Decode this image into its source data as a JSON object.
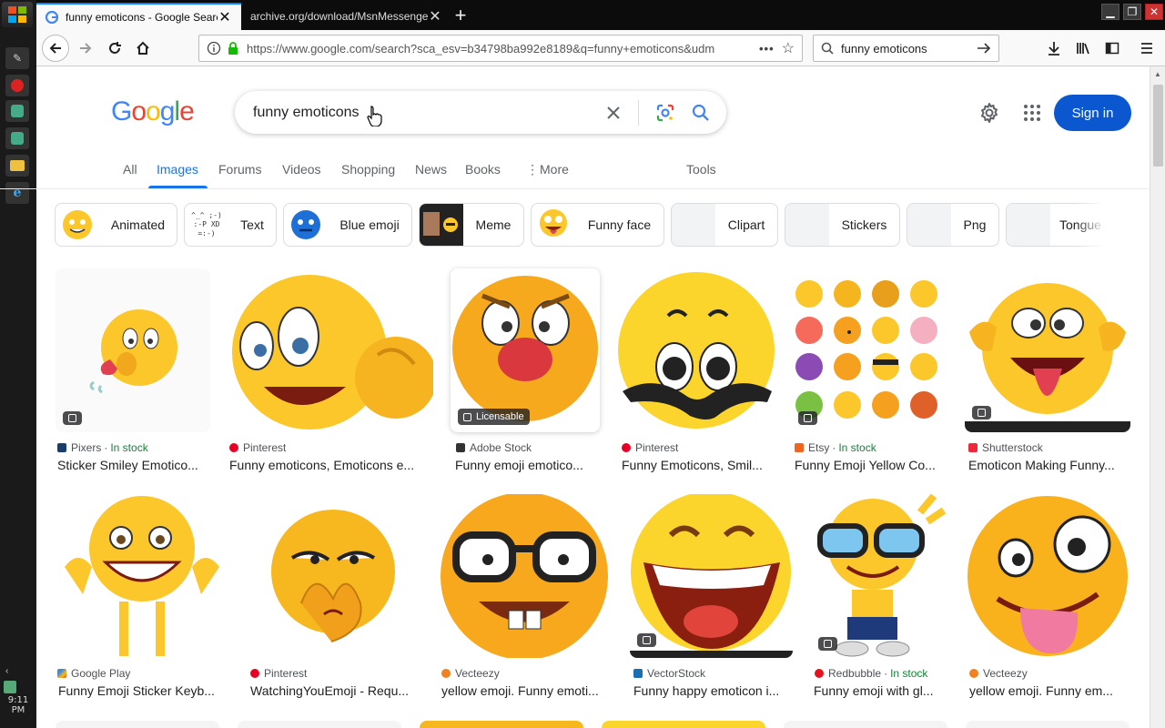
{
  "os": {
    "clock": "9:11 PM"
  },
  "browser": {
    "tabs": [
      {
        "title": "funny emoticons - Google Search",
        "active": true
      },
      {
        "title": "archive.org/download/MsnMessenger",
        "active": false
      }
    ],
    "url": "https://www.google.com/search?sca_esv=b34798ba992e8189&q=funny+emoticons&udm",
    "search_value": "funny emoticons"
  },
  "google": {
    "logo_letters": [
      "G",
      "o",
      "o",
      "g",
      "l",
      "e"
    ],
    "logo_colors": [
      "#4285f4",
      "#ea4335",
      "#fbbc05",
      "#4285f4",
      "#34a853",
      "#ea4335"
    ],
    "query": "funny emoticons",
    "sign_in": "Sign in",
    "tabs": [
      "All",
      "Images",
      "Forums",
      "Videos",
      "Shopping",
      "News",
      "Books",
      "More"
    ],
    "tools": "Tools",
    "accent": "#1a73e8"
  },
  "chips": [
    "Animated",
    "Text",
    "Blue emoji",
    "Meme",
    "Funny face",
    "Clipart",
    "Stickers",
    "Png",
    "Tongue"
  ],
  "results_row1": [
    {
      "source": "Pixers",
      "stock": "In stock",
      "title": "Sticker Smiley Emotico..."
    },
    {
      "source": "Pinterest",
      "stock": "",
      "title": "Funny emoticons, Emoticons e..."
    },
    {
      "source": "Adobe Stock",
      "stock": "",
      "title": "Funny emoji emotico...",
      "badge": "Licensable"
    },
    {
      "source": "Pinterest",
      "stock": "",
      "title": "Funny Emoticons, Smil..."
    },
    {
      "source": "Etsy",
      "stock": "In stock",
      "title": "Funny Emoji Yellow Co..."
    },
    {
      "source": "Shutterstock",
      "stock": "",
      "title": "Emoticon Making Funny..."
    }
  ],
  "results_row2": [
    {
      "source": "Google Play",
      "stock": "",
      "title": "Funny Emoji Sticker Keyb..."
    },
    {
      "source": "Pinterest",
      "stock": "",
      "title": "WatchingYouEmoji - Requ..."
    },
    {
      "source": "Vecteezy",
      "stock": "",
      "title": "yellow emoji. Funny emoti..."
    },
    {
      "source": "VectorStock",
      "stock": "",
      "title": "Funny happy emoticon i..."
    },
    {
      "source": "Redbubble",
      "stock": "In stock",
      "title": "Funny emoji with gl..."
    },
    {
      "source": "Vecteezy",
      "stock": "",
      "title": "yellow emoji. Funny em..."
    }
  ]
}
